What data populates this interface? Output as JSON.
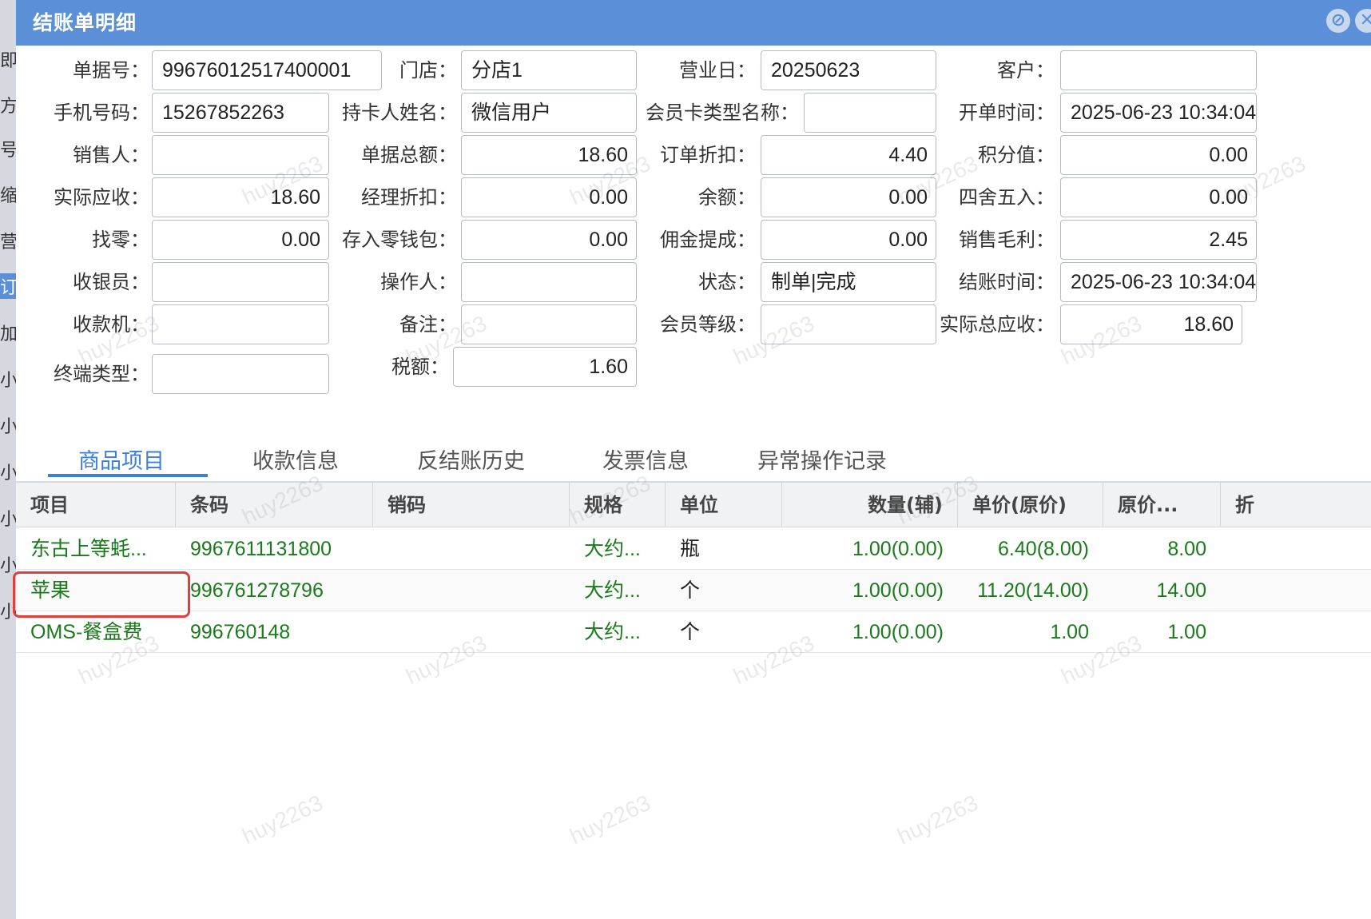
{
  "window": {
    "title": "结账单明细",
    "controls": [
      "minimize-icon",
      "close-icon"
    ],
    "accent_color": "#5b8fd8"
  },
  "form": {
    "bill_no": {
      "label": "单据号：",
      "value": "99676012517400001"
    },
    "store": {
      "label": "门店：",
      "value": "分店1"
    },
    "business_day": {
      "label": "营业日：",
      "value": "20250623"
    },
    "customer": {
      "label": "客户：",
      "value": ""
    },
    "phone": {
      "label": "手机号码：",
      "value": "15267852263"
    },
    "holder_name": {
      "label": "持卡人姓名：",
      "value": "微信用户"
    },
    "card_type": {
      "label": "会员卡类型名称：",
      "value": ""
    },
    "open_time": {
      "label": "开单时间：",
      "value": "2025-06-23 10:34:04"
    },
    "salesperson": {
      "label": "销售人：",
      "value": ""
    },
    "bill_total": {
      "label": "单据总额：",
      "value": "18.60"
    },
    "order_discount": {
      "label": "订单折扣：",
      "value": "4.40"
    },
    "points": {
      "label": "积分值：",
      "value": "0.00"
    },
    "actual_receivable": {
      "label": "实际应收：",
      "value": "18.60"
    },
    "manager_discount": {
      "label": "经理折扣：",
      "value": "0.00"
    },
    "balance": {
      "label": "余额：",
      "value": "0.00"
    },
    "rounding": {
      "label": "四舍五入：",
      "value": "0.00"
    },
    "change": {
      "label": "找零：",
      "value": "0.00"
    },
    "wallet_deposit": {
      "label": "存入零钱包：",
      "value": "0.00"
    },
    "commission": {
      "label": "佣金提成：",
      "value": "0.00"
    },
    "gross_profit": {
      "label": "销售毛利：",
      "value": "2.45"
    },
    "cashier": {
      "label": "收银员：",
      "value": ""
    },
    "operator": {
      "label": "操作人：",
      "value": ""
    },
    "status": {
      "label": "状态：",
      "value": "制单|完成"
    },
    "checkout_time": {
      "label": "结账时间：",
      "value": "2025-06-23 10:34:04"
    },
    "pos_machine": {
      "label": "收款机：",
      "value": ""
    },
    "remark": {
      "label": "备注：",
      "value": ""
    },
    "member_level": {
      "label": "会员等级：",
      "value": ""
    },
    "actual_total_receivable": {
      "label": "实际总应收：",
      "value": "18.60"
    },
    "terminal_type": {
      "label": "终端类型：",
      "value": ""
    },
    "tax": {
      "label": "税额：",
      "value": "1.60"
    }
  },
  "tabs": [
    {
      "label": "商品项目",
      "active": true
    },
    {
      "label": "收款信息",
      "active": false
    },
    {
      "label": "反结账历史",
      "active": false
    },
    {
      "label": "发票信息",
      "active": false
    },
    {
      "label": "异常操作记录",
      "active": false
    }
  ],
  "grid": {
    "columns": [
      "项目",
      "条码",
      "销码",
      "规格",
      "单位",
      "数量(辅)",
      "单价(原价)",
      "原价...",
      "折"
    ],
    "rows": [
      {
        "item": "东古上等蚝...",
        "barcode": "9967611131800",
        "sales_code": "",
        "spec": "大约...",
        "unit": "瓶",
        "qty": "1.00(0.00)",
        "price": "6.40(8.00)",
        "orig": "8.00"
      },
      {
        "item": "苹果",
        "barcode": "996761278796",
        "sales_code": "",
        "spec": "大约...",
        "unit": "个",
        "qty": "1.00(0.00)",
        "price": "11.20(14.00)",
        "orig": "14.00"
      },
      {
        "item": "OMS-餐盒费",
        "barcode": "996760148",
        "sales_code": "",
        "spec": "大约...",
        "unit": "个",
        "qty": "1.00(0.00)",
        "price": "1.00",
        "orig": "1.00"
      }
    ],
    "row_text_color": "#1b7a1b",
    "highlight_color": "#e0403a"
  },
  "watermark": "huy2263",
  "left_edge_glyphs": [
    "即",
    "方",
    "号",
    "缩",
    "营",
    "订",
    "加",
    "小",
    "小",
    "小",
    "小",
    "小",
    "小"
  ]
}
